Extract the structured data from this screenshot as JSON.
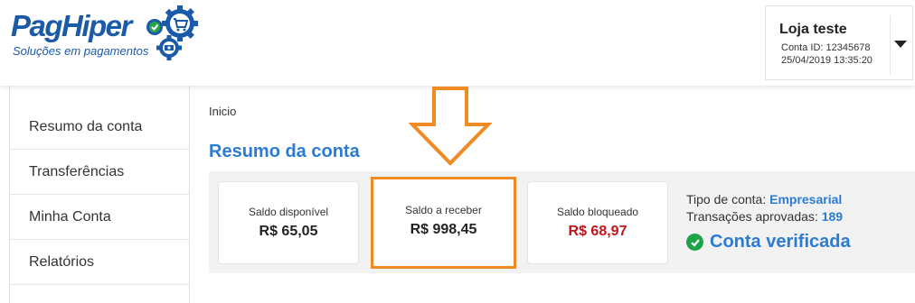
{
  "brand": {
    "name": "PagHiper",
    "tagline": "Soluções em pagamentos"
  },
  "account": {
    "store_name": "Loja teste",
    "account_id": "Conta ID: 12345678",
    "datetime": "25/04/2019 13:35:20"
  },
  "sidebar": {
    "items": [
      {
        "label": "Resumo da conta"
      },
      {
        "label": "Transferências"
      },
      {
        "label": "Minha Conta"
      },
      {
        "label": "Relatórios"
      }
    ]
  },
  "breadcrumb": "Inicio",
  "page_title": "Resumo da conta",
  "balances": [
    {
      "label": "Saldo disponível",
      "value": "R$ 65,05"
    },
    {
      "label": "Saldo a receber",
      "value": "R$ 998,45"
    },
    {
      "label": "Saldo bloqueado",
      "value": "R$ 68,97"
    }
  ],
  "info": {
    "account_type_label": "Tipo de conta:",
    "account_type_value": "Empresarial",
    "approved_label": "Transações aprovadas:",
    "approved_value": "189",
    "verified_label": "Conta verificada"
  },
  "colors": {
    "brand_blue": "#1b5aa8",
    "accent_blue": "#2b7bd4",
    "highlight_orange": "#f08a24",
    "blocked_red": "#c0141a",
    "verified_green": "#1ea448"
  },
  "icons": {
    "logo_gears": "gears-check-cart-icon",
    "dropdown": "caret-down-icon",
    "annotation_arrow": "down-arrow-annotation",
    "verified": "check-circle-icon"
  }
}
